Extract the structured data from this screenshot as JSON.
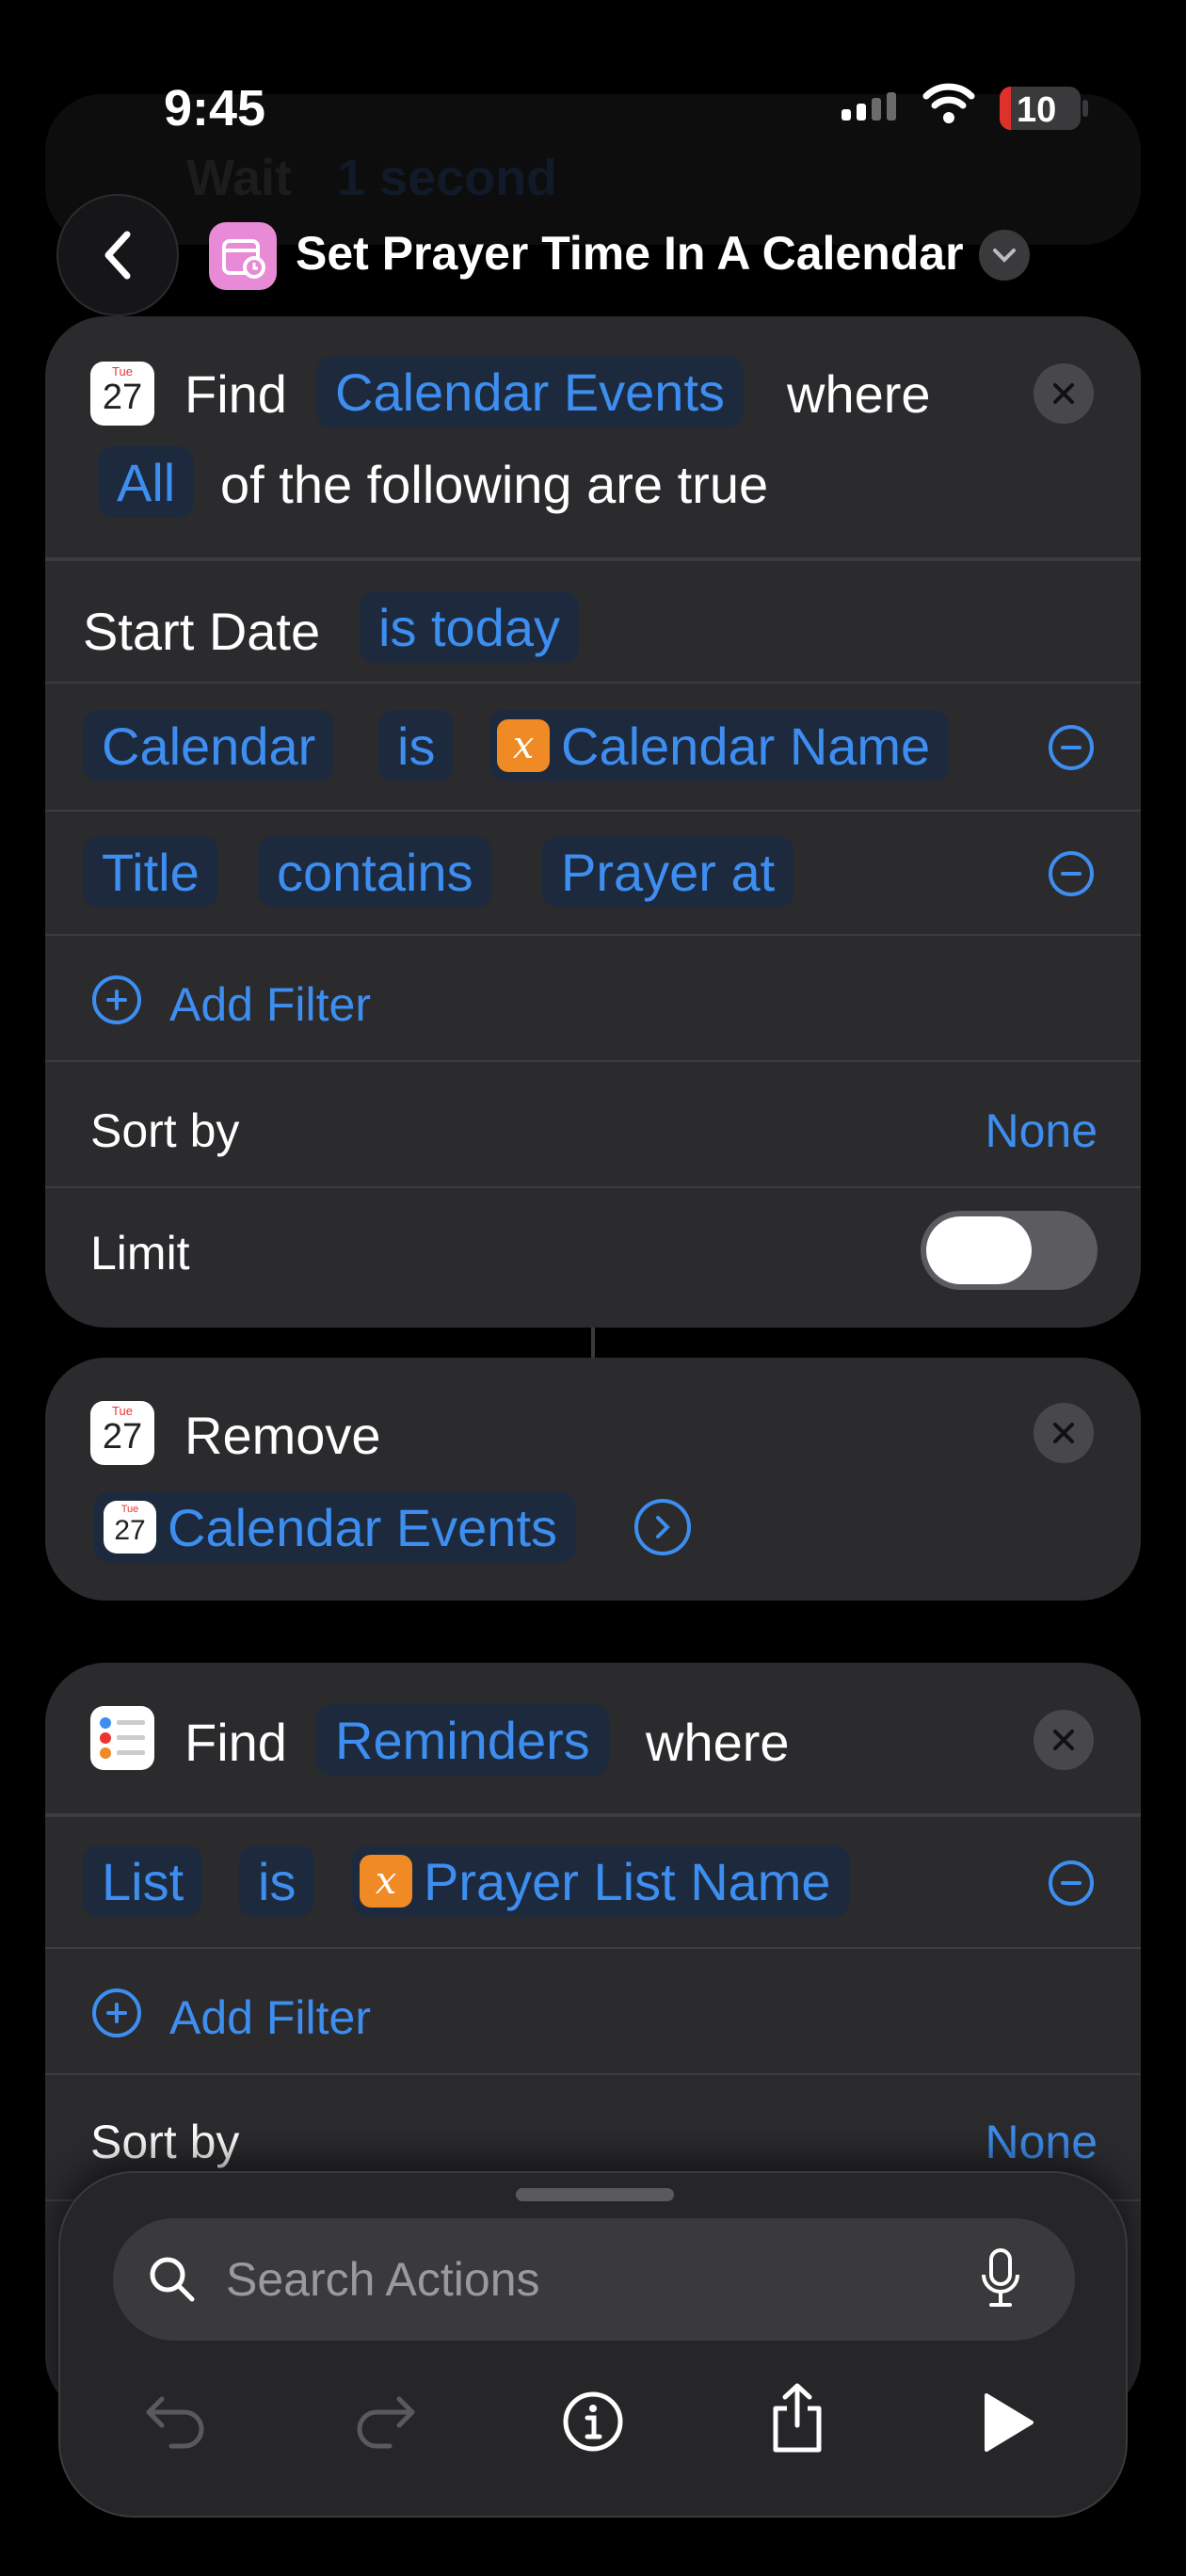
{
  "status": {
    "time": "9:45",
    "battery": "10"
  },
  "background_hint": {
    "wait": "Wait",
    "value": "1 second"
  },
  "header": {
    "title": "Set Prayer Time In A Calendar",
    "back_label": "Back"
  },
  "find_events": {
    "find": "Find",
    "entity": "Calendar Events",
    "where": "where",
    "all": "All",
    "following": "of the following are true",
    "start_date_label": "Start Date",
    "start_date_value": "is today",
    "filter1": {
      "field": "Calendar",
      "op": "is",
      "value": "Calendar Name"
    },
    "filter2": {
      "field": "Title",
      "op": "contains",
      "value": "Prayer at"
    },
    "add_filter": "Add Filter",
    "sort_by": "Sort by",
    "sort_value": "None",
    "limit": "Limit",
    "limit_on": false
  },
  "remove": {
    "label": "Remove",
    "entity": "Calendar Events"
  },
  "find_reminders": {
    "find": "Find",
    "entity": "Reminders",
    "where": "where",
    "filter1": {
      "field": "List",
      "op": "is",
      "value": "Prayer List Name"
    },
    "add_filter": "Add Filter",
    "sort_by": "Sort by",
    "sort_value": "None"
  },
  "calendar_icon": {
    "day": "Tue",
    "date": "27"
  },
  "search": {
    "placeholder": "Search Actions"
  },
  "colors": {
    "accent": "#3d8ef0",
    "card": "#2b2b2e",
    "variable": "#f08a24"
  }
}
